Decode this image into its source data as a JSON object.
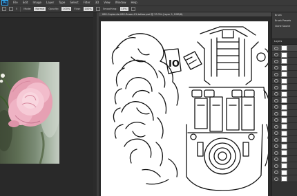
{
  "app": {
    "logo_text": "Ps"
  },
  "menu": {
    "items": [
      "File",
      "Edit",
      "Image",
      "Layer",
      "Type",
      "Select",
      "Filter",
      "3D",
      "View",
      "Window",
      "Help"
    ]
  },
  "options_bar": {
    "size_value": "5",
    "mode_label": "Mode:",
    "mode_value": "Normal",
    "opacity_label": "Opacity:",
    "opacity_value": "100%",
    "flow_label": "Flow:",
    "flow_value": "100%",
    "smoothing_label": "Smoothing:",
    "smoothing_value": "10%"
  },
  "documents": {
    "right_tab_title": "IMG-Copiar-de-IMG-flower-01-tattoo.psd @ 33.3% (Layer 1, RGB/8)"
  },
  "panels": {
    "top_rows": [
      "Brush",
      "Brush Presets",
      "Clone Source"
    ],
    "layers_header": "Layers",
    "layer_count": 21,
    "selected_index": 0
  },
  "colors": {
    "ui_dark": "#282828",
    "ui_mid": "#3a3a3a",
    "canvas": "#ffffff",
    "accent": "#35b6ff",
    "rose": "#e9a2b6"
  }
}
